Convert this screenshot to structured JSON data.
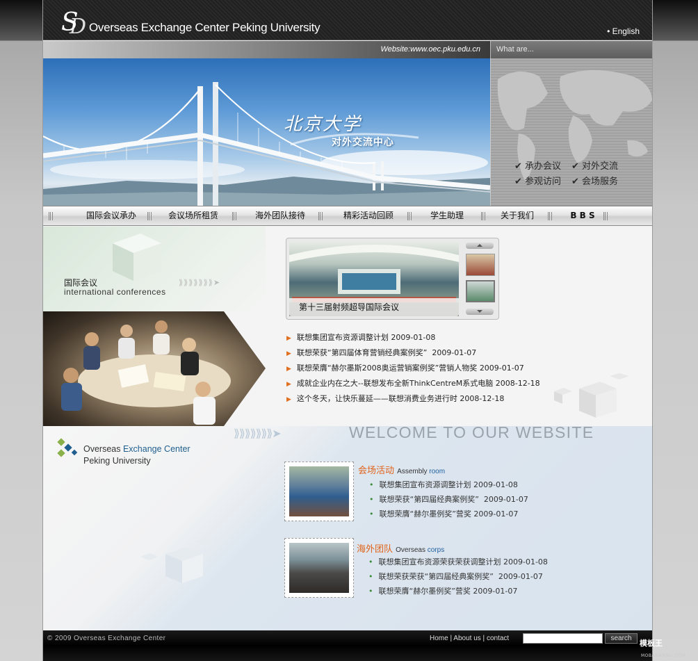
{
  "header": {
    "logo_text": "Overseas Exchange Center Peking University",
    "lang_link": "• English"
  },
  "url_strip": {
    "website": "Website:www.oec.pku.edu.cn",
    "what_label": "What are..."
  },
  "banner": {
    "title": "北京大学",
    "subtitle": "对外交流中心"
  },
  "services": [
    "✔ 承办会议",
    "✔ 对外交流",
    "✔ 参观访问",
    "✔ 会场服务"
  ],
  "nav": [
    "国际会议承办",
    "会议场所租赁",
    "海外团队接待",
    "精彩活动回顾",
    "学生助理",
    "关于我们",
    "B B S"
  ],
  "conference": {
    "cn": "国际会议",
    "en": "international conferences"
  },
  "feature": {
    "caption": "第十三届射频超导国际会议"
  },
  "news": [
    {
      "title": "联想集团宣布资源调整计划",
      "date": "2009-01-08"
    },
    {
      "title": "联想荣获“第四届体育营销经典案例奖”",
      "date": "2009-01-07"
    },
    {
      "title": "联想荣膺“赫尔墨斯2008奥运营销案例奖”营销人物奖",
      "date": "2009-01-07"
    },
    {
      "title": "成就企业内在之大--联想发布全新ThinkCentreM系式电脑",
      "date": "2008-12-18"
    },
    {
      "title": "这个冬天，让快乐蔓延——联想消费业务进行时",
      "date": "2008-12-18"
    }
  ],
  "welcome": "WELCOME TO OUR WEBSITE",
  "center_logo": {
    "line1_a": "Overseas ",
    "line1_b": "Exchange Center",
    "line2": "Peking University"
  },
  "sections": [
    {
      "title_cn": "会场活动",
      "title_en_a": "Assembly ",
      "title_en_b": "room",
      "items": [
        {
          "title": "联想集团宣布资源调整计划",
          "date": "2009-01-08"
        },
        {
          "title": "联想荣获“第四届经典案例奖”",
          "date": "2009-01-07"
        },
        {
          "title": "联想荣膺“赫尔墨例奖”营奖",
          "date": "2009-01-07"
        }
      ]
    },
    {
      "title_cn": "海外团队",
      "title_en_a": "Overseas ",
      "title_en_b": "corps",
      "items": [
        {
          "title": "联想集团宣布资源荣获荣获调整计划",
          "date": "2009-01-08"
        },
        {
          "title": "联想荣获荣获“第四届经典案例奖”",
          "date": "2009-01-07"
        },
        {
          "title": "联想荣膺“赫尔墨例奖”营奖",
          "date": "2009-01-07"
        }
      ]
    }
  ],
  "footer": {
    "copyright": "© 2009 Overseas Exchange Center",
    "link_home": "Home",
    "link_about": "About us",
    "link_contact": "contact",
    "sep": " | ",
    "search_value": "",
    "search_button": "search"
  },
  "watermark": {
    "main": "模板王",
    "sub": "MOBANWANG.COM"
  }
}
